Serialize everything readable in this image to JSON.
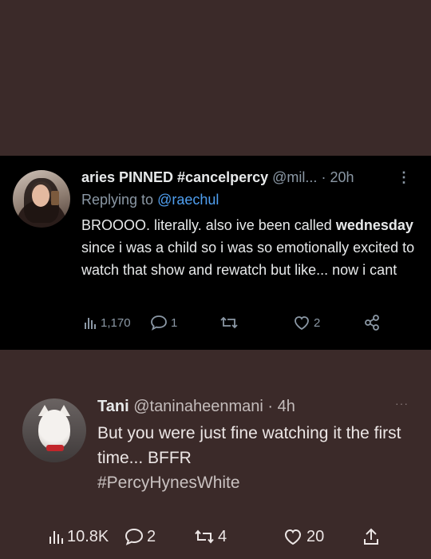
{
  "tweet1": {
    "display_name": "aries PINNED #cancelpercy",
    "handle": "@mil...",
    "time": "· 20h",
    "more_icon": "more-vertical-icon",
    "replying_prefix": "Replying to",
    "replying_to": "@raechul",
    "body_part1": "BROOOO. literally. also ive been called",
    "body_bold": "wednesday",
    "body_part2": "since i was a child so i was so emotionally excited to watch that show and rewatch but like... now i cant",
    "views": "1,170",
    "replies": "1",
    "retweets": "",
    "likes": "2"
  },
  "tweet2": {
    "display_name": "Tani",
    "handle": "@taninaheenmani · 4h",
    "more_label": "···",
    "body": "But you were just fine watching it the first time... BFFR",
    "hashtag": "#PercyHynesWhite",
    "views": "10.8K",
    "replies": "2",
    "retweets": "4",
    "likes": "20"
  },
  "colors": {
    "background": "#3b2a29",
    "tweet1_background": "#000000",
    "link": "#4f9ff0",
    "muted": "#8b98a5"
  }
}
